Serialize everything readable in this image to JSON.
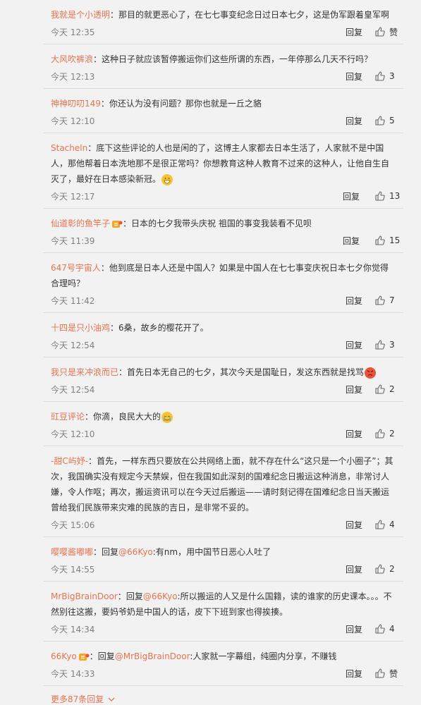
{
  "comments": [
    {
      "user": "我就是个小透明",
      "sep": "：",
      "text": "那目的就更恶心了，在七七事变纪念日过日本七夕，这是伪军跟着皇军啊",
      "time": "今天 12:35",
      "reply": "回复",
      "likes": "赞"
    },
    {
      "user": "大风吹裤浪",
      "sep": "：",
      "text": "这种日子就应该暂停搬运你们这些所谓的东西，一年停那么几天不行吗？",
      "time": "今天 12:13",
      "reply": "回复",
      "likes": "3"
    },
    {
      "user": "神神叨叨149",
      "sep": "：",
      "text": "你还认为没有问题？那你也就是一丘之貉",
      "time": "今天 12:10",
      "reply": "回复",
      "likes": "5"
    },
    {
      "user": "Stacheln",
      "sep": "：",
      "text": "底下这些评论的人也是闲的了，这博主人家都去日本生活了，人家就不是中国人，那他帮着日本洗地那不是很正常吗？你想教育这种人教育不过来的这种人，让他自生自灭了，最好在日本感染新冠。",
      "emoji": "grin-emoji",
      "time": "今天 12:17",
      "reply": "回复",
      "likes": "13"
    },
    {
      "user": "仙道彰的鱼竿子",
      "badge": true,
      "sep": "：",
      "text": "日本的七夕我带头庆祝 祖国的事变我装看不见呗",
      "time": "今天 11:39",
      "reply": "回复",
      "likes": "15"
    },
    {
      "user": "647号宇宙人",
      "sep": "：",
      "text": "他到底是日本人还是中国人？如果是中国人在七七事变庆祝日本七夕你觉得合理吗？",
      "time": "今天 11:42",
      "reply": "回复",
      "likes": "7"
    },
    {
      "user": "十四是只小油鸡",
      "sep": "：",
      "text": "6桑，故乡的樱花开了。",
      "time": "今天 12:54",
      "reply": "回复",
      "likes": "3"
    },
    {
      "user": "我只是来冲浪而已",
      "sep": "：",
      "text": "首先日本无自己的七夕，其次今天是国耻日，发这东西就是找骂",
      "emoji": "angry-emoji",
      "time": "今天 12:54",
      "reply": "回复",
      "likes": "2"
    },
    {
      "user": "豇豆评论",
      "sep": "：",
      "text": "你滴，良民大大的",
      "emoji": "cry-emoji",
      "time": "今天 12:10",
      "reply": "回复",
      "likes": "2"
    },
    {
      "user": "-甜C屿妤-",
      "sep": "：",
      "text": "首先，一样东西只要放在公共网络上面，就不存在什么“这只是一个小圈子”；其次，我国确实没有规定今天禁娱，但在我国如此深刻的国难纪念日搬运这种消息，非常讨人嫌，令人作呕；再次，搬运资讯可以在今天过后搬运——请时刻记得在国难纪念日当天搬运曾给我们民族带来灾难的民族的吉日，是非常不妥的。",
      "time": "今天 15:06",
      "reply": "回复",
      "likes": "4"
    },
    {
      "user": "嘤嘤酱嘟嘟",
      "sep": "：",
      "pre": "回复",
      "mention": "@66Kyo",
      "text": ":有nm，用中国节日恶心人吐了",
      "time": "今天 14:55",
      "reply": "回复",
      "likes": "2"
    },
    {
      "user": "MrBigBrainDoor",
      "sep": "：",
      "pre": "回复",
      "mention": "@66Kyo",
      "text": ":所以搬运的人又是什么国籍，读的谁家的历史课本。。。不然别往这搬，要妈爷奶是中国人的话，皮下下班到家也得挨揍。",
      "time": "今天 14:34",
      "reply": "回复",
      "likes": "4"
    },
    {
      "user": "66Kyo",
      "badge": true,
      "sep": "：",
      "pre": "回复",
      "mention": "@MrBigBrainDoor",
      "text": ":人家就一字幕组，纯圈内分享，不赚钱",
      "time": "今天 14:33",
      "reply": "回复",
      "likes": "赞"
    }
  ],
  "more": {
    "label": "更多87条回复"
  }
}
